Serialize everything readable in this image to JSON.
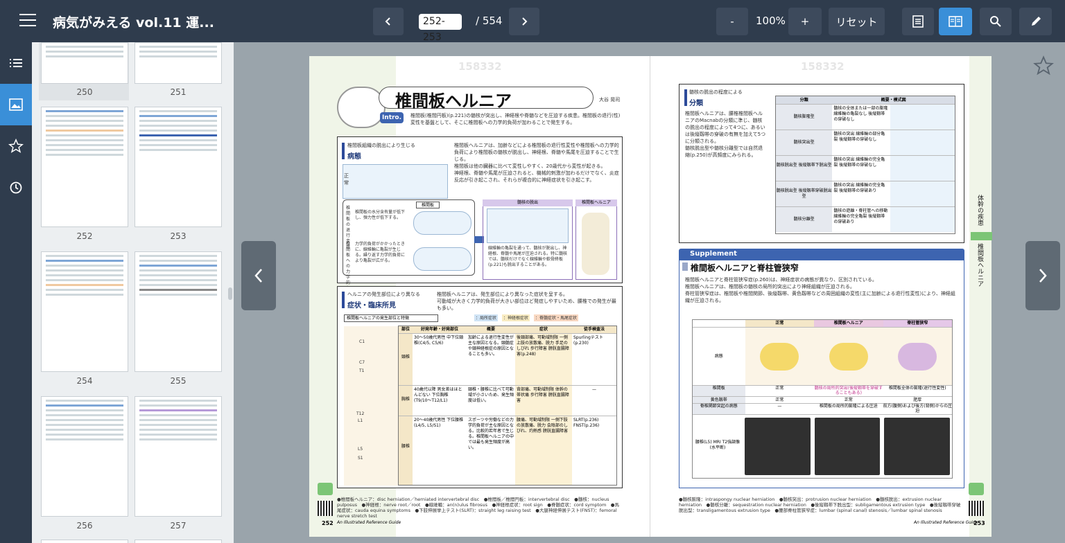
{
  "app": {
    "title": "病気がみえる vol.11 運...",
    "menu_icon": "hamburger-icon"
  },
  "toolbar": {
    "prev_page": "‹",
    "page_input_value": "252-253",
    "page_total": "/ 554",
    "next_page": "›",
    "zoom_out": "-",
    "zoom_level": "100%",
    "zoom_in": "+",
    "reset": "リセット",
    "icons": [
      "single-page-icon",
      "spread-view-icon",
      "search-icon",
      "pen-icon"
    ]
  },
  "sidebar": {
    "rail_icons": [
      "list-icon",
      "image-icon",
      "star-icon",
      "history-icon"
    ],
    "thumbnails": [
      {
        "label": "250"
      },
      {
        "label": "251"
      },
      {
        "label": "252"
      },
      {
        "label": "253"
      },
      {
        "label": "254"
      },
      {
        "label": "255"
      },
      {
        "label": "256"
      },
      {
        "label": "257"
      }
    ]
  },
  "left_page": {
    "watermark": "158332",
    "title": "椎間板ヘルニア",
    "author": "大谷 晃司",
    "intro_badge": "Intro.",
    "intro_text": "椎間板(椎間円板)(p.221)の髄核が突出し、神経根や脊髄などを圧迫する疾患。椎間板の退行(性)変性を基盤として、そこに椎間板への力学的負荷が加わることで発生する。",
    "section1_sub": "椎間板組織の脱出により生じる",
    "section1_title": "病態",
    "section1_bullets": [
      "椎間板ヘルニアは、加齢などによる椎間板の退行性変性や椎間板への力学的負荷により椎間板の髄核が脱出し、神経根、脊髄や馬尾を圧迫することで生じる。",
      "椎間板は他の臓器に比べて変性しやすく、20歳代から変性が起きる。",
      "神経根、脊髄や馬尾が圧迫されると、機械的刺激が加わるだけでなく、炎症反応が引き起こされ、それらが複合的に神経症状を引き起こす。"
    ],
    "diagram_labels": {
      "normal": "正常",
      "degeneration": "椎間板の退行変性",
      "load": "椎間板への力学的負荷",
      "disc_box": "椎間板",
      "prolapse_box": "髄核の脱出",
      "hernia_box": "椎間板ヘルニア",
      "degeneration_text": "椎間板の水分含有量が低下し、弾力性が低下する。",
      "load_text": "力学的負荷がかかったときに、線維輪に亀裂が生じる。繰り返す力学的負荷により亀裂が広がる。",
      "prolapse_text": "線維輪の亀裂を通って、髄核が脱出し、神経根、脊髄や馬尾が圧迫される。特に髄核では、髄核だけでなく線維輪や軟骨終板(p.221)も脱出することがある。"
    },
    "section2_sub": "ヘルニアの発生部位により異なる",
    "section2_title": "症状・臨床所見",
    "section2_bullets": [
      "椎間板ヘルニアは、発生部位により異なった症状を呈する。",
      "可動域が大きく力学的負荷が大きい部位ほど発症しやすいため、腰椎での発生が最も多い。"
    ],
    "table_caption": "椎間板ヘルニアの発生部位と特徴",
    "legend": [
      "：局所症状",
      "：神経根症状",
      "：脊髄症状・馬尾症状"
    ],
    "table_headers": [
      "部位",
      "好発年齢・好発部位",
      "概要",
      "症状",
      "徒手検査法"
    ],
    "table_rows": [
      {
        "site": "頸椎",
        "age": "30〜50歳代男性 中下位頸椎(C4/5, C5/6)",
        "overview": "加齢による退行性変性が主な原因となる。頸髄症や頸神経根症の原因となることも多い。",
        "symptoms": "後頸部痛、可動域制限 一側上肢の放散痛、脱力 手足のしびれ 歩行障害 膀胱直腸障害(p.248)",
        "test": "Spurlingテスト(p.230)"
      },
      {
        "site": "胸椎",
        "age": "40歳代以降 男女差はほとんどない 下位胸椎(T9/10〜T12/L1)",
        "overview": "頸椎・腰椎に比べて可動域が小さいため、発生頻度は低い。",
        "symptoms": "背部痛、可動域制限 体幹の帯状痛 歩行障害 膀胱直腸障害",
        "test": "—"
      },
      {
        "site": "腰椎",
        "age": "20〜40歳代男性 下位腰椎(L4/5, L5/S1)",
        "overview": "スポーツや労働などの力学的負荷が主な原因となる。比較的若年者で生じる。椎間板ヘルニアの中では最も発生頻度が高い。",
        "symptoms": "腰痛、可動域制限 一側下肢の放散痛、脱力 会陰部のしびれ、灼熱感 膀胱直腸障害",
        "test": "SLRT(p.236) FNST(p.236)"
      }
    ],
    "spine_labels": [
      "C1",
      "C7",
      "T1",
      "T12",
      "L1",
      "L5",
      "S1"
    ],
    "footer_terms": "●椎間板ヘルニア：disc herniation／herniated intervertebral disc　●椎間板／椎間円板：intervertebral disc　●髄核：nucleus pulposus　●神経根：nerve root／root　●線維輪：an(n)ulus fibrosus　●神経根症状：root sign　●脊髄症状：cord symptom　●馬尾症状：cauda equina symptoms　●下肢伸展挙上テスト(SLRT)：straight leg raising test　●大腿神経伸展テスト(FNST)：femoral nerve stretch test",
    "footer_book": "An Illustrated Reference Guide",
    "page_number": "252"
  },
  "right_page": {
    "watermark": "158332",
    "section_sub": "髄核の脱出の程度による",
    "section_title": "分類",
    "bullets": [
      "椎間板ヘルニアは、腰椎椎間板ヘルニアのMacnabの分類に準じ、髄核の脱出の程度によって4つに、あるいは後縦靱帯の穿破の有無を加えて5つに分類される。",
      "髄核脱出型や髄核分離型では自然退縮(p.250)が高頻度にみられる。"
    ],
    "class_headers": [
      "分類",
      "概要・模式図"
    ],
    "class_rows": [
      {
        "name": "髄核膨隆型",
        "desc": "髄核の全体または一部の膨隆 線維輪の亀裂なし 後縦靱帯の穿破なし"
      },
      {
        "name": "髄核突出型",
        "desc": "髄核の突出 線維輪の部分亀裂 後縦靱帯の穿破なし"
      },
      {
        "name": "髄核脱出型 後縦靱帯下脱出型",
        "desc": "髄核の突出 線維輪の完全亀裂 後縦靱帯の穿破なし"
      },
      {
        "name": "髄核脱出型 後縦靱帯穿破脱出型",
        "desc": "髄核の突出 線維輪の完全亀裂 後縦靱帯の穿破あり"
      },
      {
        "name": "髄核分離型",
        "desc": "髄核の遊離・脊柱管への移動 線維輪の完全亀裂 後縦靱帯の穿破あり"
      }
    ],
    "supplement_label": "Supplement",
    "supplement_title": "椎間板ヘルニアと脊柱管狭窄",
    "supplement_bullets": [
      "椎間板ヘルニアと脊柱管狭窄症(p.260)は、神経症状の病態が異なり、区別されている。",
      "椎間板ヘルニアは、椎間板の髄核の局所的突出により神経組織が圧迫される。",
      "脊柱管狭窄症は、椎間板や椎間関節、後縦靱帯、黄色靱帯などの周囲組織の変性(主に加齢による退行性変性)により、神経組織が圧迫される。"
    ],
    "compare_headers": [
      "正常",
      "椎間板ヘルニア",
      "脊柱管狭窄"
    ],
    "compare_rows": [
      {
        "label": "病態",
        "values": [
          "",
          "",
          ""
        ]
      },
      {
        "label": "椎間板",
        "values": [
          "正常",
          "髄核の局所的突出(後縦靱帯を穿破することもある)",
          "椎間板全体の膨隆(退行性変性)"
        ]
      },
      {
        "label": "黄色靱帯",
        "values": [
          "正常",
          "正常",
          "肥厚"
        ]
      },
      {
        "label": "脊椎関節突起の病態",
        "values": [
          "—",
          "椎間板の局所的膨隆による圧迫",
          "前方(腹側)および後方(背側)からの圧迫"
        ]
      },
      {
        "label": "腰椎(L5) MRI T2強調像(水平断)",
        "values": [
          "",
          "",
          ""
        ]
      }
    ],
    "side_tab_top": "体幹の疾患",
    "side_tab_bottom": "椎間板ヘルニア",
    "footer_terms": "●髄核膨隆：intraspongy nuclear herniation　●髄核突出：protrusion nuclear herniation　●髄核脱出：extrusion nuclear herniation　●髄核分離：sequestration nuclear herniation　●後縦靱帯下脱出型：subligamentous extrusion type　●後縦靱帯穿破脱出型：transligamentous extrusion type　●腰部脊柱管狭窄症：lumbar (spinal canal) stenosis／lumbar spinal stenosis",
    "footer_book": "An Illustrated Reference Guide",
    "page_number": "253"
  },
  "colors": {
    "topbar": "#2f3c4d",
    "accent": "#3a8fd8",
    "viewer_bg": "#9aa4ab"
  }
}
